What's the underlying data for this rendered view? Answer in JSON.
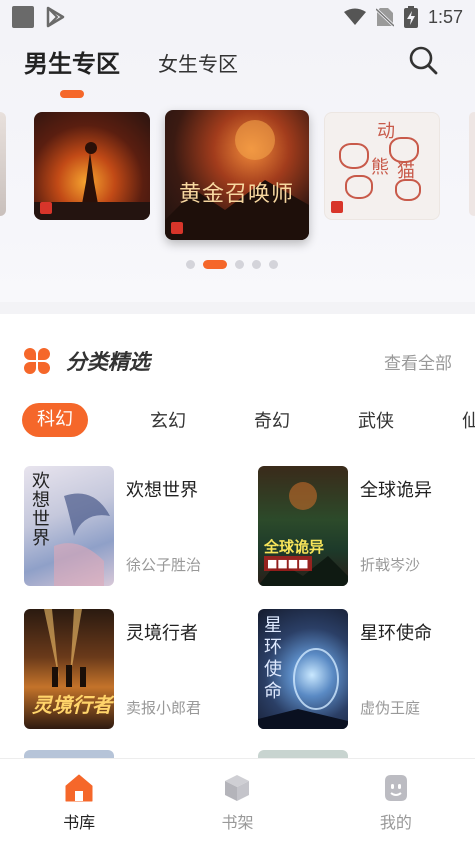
{
  "status_bar": {
    "time": "1:57",
    "left_icons": [
      "notification-square-icon",
      "play-store-icon"
    ],
    "right_icons": [
      "wifi-icon",
      "no-sim-icon",
      "battery-charging-icon"
    ]
  },
  "header": {
    "tabs": [
      {
        "label": "男生专区",
        "active": true
      },
      {
        "label": "女生专区",
        "active": false
      }
    ],
    "search_icon": "search-icon"
  },
  "carousel": {
    "featured_title": "黄金召唤师",
    "side_cover_text": [
      "动",
      "熊",
      "猫"
    ],
    "pages": 5,
    "active_page": 2
  },
  "category_section": {
    "icon": "clover-icon",
    "title": "分类精选",
    "see_all": "查看全部",
    "genres": [
      "科幻",
      "玄幻",
      "奇幻",
      "武侠",
      "仙侠"
    ],
    "active_genre": "科幻",
    "books": [
      {
        "title": "欢想世界",
        "author": "徐公子胜治",
        "cover_text": "欢想世界"
      },
      {
        "title": "全球诡异",
        "author": "折戟岑沙",
        "cover_text": "全球诡异"
      },
      {
        "title": "灵境行者",
        "author": "卖报小郎君",
        "cover_text": "灵境行者"
      },
      {
        "title": "星环使命",
        "author": "虚伪王庭",
        "cover_text": "星环使命"
      }
    ]
  },
  "bottom_nav": {
    "items": [
      {
        "label": "书库",
        "icon": "home-icon",
        "active": true
      },
      {
        "label": "书架",
        "icon": "bookshelf-icon",
        "active": false
      },
      {
        "label": "我的",
        "icon": "profile-icon",
        "active": false
      }
    ]
  },
  "colors": {
    "accent": "#f5672a",
    "inactive_text": "#999999",
    "background_top": "#f3f3f8"
  }
}
